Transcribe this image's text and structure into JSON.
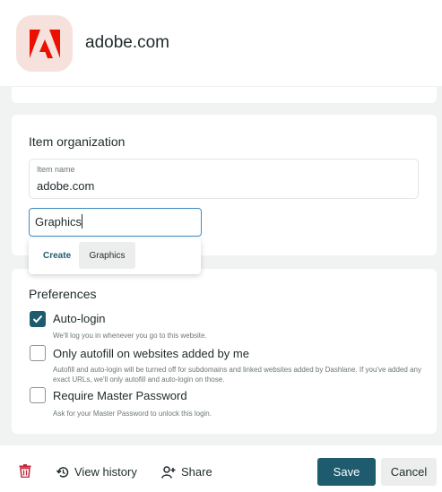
{
  "header": {
    "title": "adobe.com",
    "logo_icon": "adobe-logo-icon"
  },
  "organization": {
    "title": "Item organization",
    "item_name_label": "Item name",
    "item_name_value": "adobe.com",
    "category_input_value": "Graphics",
    "dropdown": {
      "create_label": "Create",
      "suggestion": "Graphics"
    }
  },
  "preferences": {
    "title": "Preferences",
    "options": [
      {
        "label": "Auto-login",
        "checked": true,
        "description": "We'll log you in whenever you go to this website."
      },
      {
        "label": "Only autofill on websites added by me",
        "checked": false,
        "description": "Autofill and auto-login will be turned off for subdomains and linked websites added by Dashlane. If you've added any exact URLs, we'll only autofill and auto-login on those."
      },
      {
        "label": "Require Master Password",
        "checked": false,
        "description": "Ask for your Master Password to unlock this login."
      }
    ]
  },
  "footer": {
    "view_history_label": "View history",
    "share_label": "Share",
    "save_label": "Save",
    "cancel_label": "Cancel"
  },
  "colors": {
    "accent": "#1e5b6e",
    "logo_red": "#eb1000",
    "logo_bg": "#f6e1dd",
    "trash_red": "#c0283a"
  }
}
